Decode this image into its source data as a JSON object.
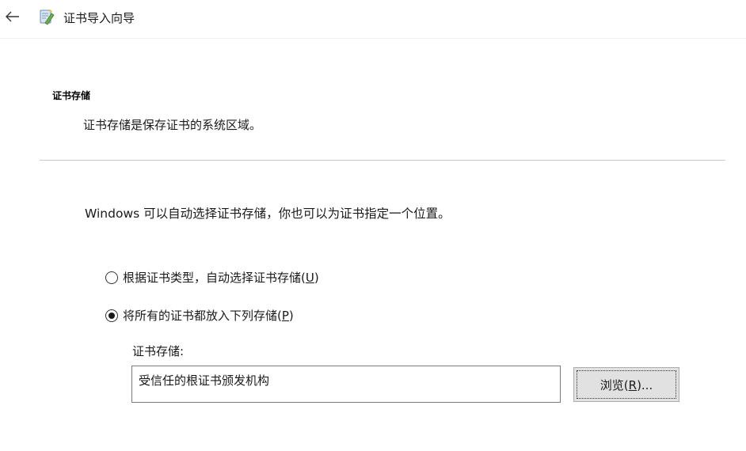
{
  "window": {
    "title": "证书导入向导"
  },
  "icons": {
    "back": "back-arrow-icon",
    "wizard": "certificate-wizard-icon"
  },
  "section": {
    "heading": "证书存储",
    "description": "证书存储是保存证书的系统区域。"
  },
  "intro": "Windows 可以自动选择证书存储，你也可以为证书指定一个位置。",
  "options": [
    {
      "label_prefix": "根据证书类型，自动选择证书存储(",
      "mnemonic": "U",
      "label_suffix": ")",
      "selected": false
    },
    {
      "label_prefix": "将所有的证书都放入下列存储(",
      "mnemonic": "P",
      "label_suffix": ")",
      "selected": true
    }
  ],
  "store": {
    "label": "证书存储:",
    "value": "受信任的根证书颁发机构"
  },
  "browse": {
    "label_prefix": "浏览(",
    "mnemonic": "R",
    "label_suffix": ")..."
  },
  "colors": {
    "divider": "#c9c9c9",
    "button_bg": "#e1e1e1",
    "input_border": "#7a7a7a"
  }
}
